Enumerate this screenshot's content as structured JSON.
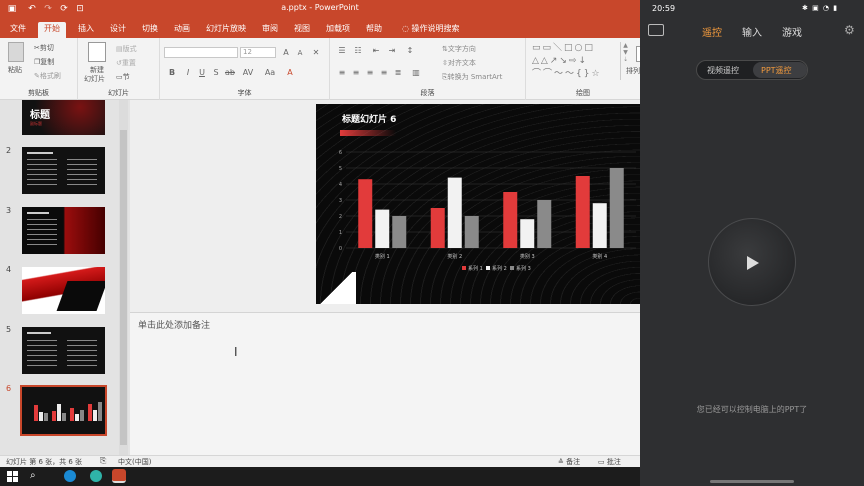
{
  "app": {
    "filename": "a.pptx",
    "separator": "-",
    "name": "PowerPoint"
  },
  "ribbon": {
    "tabs": [
      "文件",
      "开始",
      "插入",
      "设计",
      "切换",
      "动画",
      "幻灯片放映",
      "审阅",
      "视图",
      "加载项",
      "帮助"
    ],
    "tell_me": "操作说明搜索",
    "clipboard": {
      "paste": "粘贴",
      "cut": "剪切",
      "copy": "复制",
      "format_painter": "格式刷",
      "label": "剪贴板"
    },
    "slides": {
      "new_slide": "新建",
      "new_slide2": "幻灯片",
      "layout": "版式",
      "reset": "重置",
      "section": "节",
      "label": "幻灯片"
    },
    "font": {
      "size": "12",
      "label": "字体",
      "buttons": [
        "B",
        "I",
        "U",
        "S",
        "ab",
        "AV",
        "Aa",
        "A"
      ],
      "grow": "A",
      "shrink": "A"
    },
    "paragraph": {
      "text_direction": "文字方向",
      "align_text": "对齐文本",
      "smartart": "转换为 SmartArt",
      "label": "段落"
    },
    "drawing": {
      "arrange": "排列",
      "label": "绘图"
    }
  },
  "thumbnails": [
    {
      "num": "2"
    },
    {
      "num": "3"
    },
    {
      "num": "4"
    },
    {
      "num": "5"
    },
    {
      "num": "6"
    }
  ],
  "thumb1": {
    "title": "标题",
    "sub": "副标题"
  },
  "slide": {
    "title": "标题幻灯片 6"
  },
  "chart_data": {
    "type": "bar",
    "categories": [
      "类别 1",
      "类别 2",
      "类别 3",
      "类别 4"
    ],
    "series": [
      {
        "name": "系列 1",
        "values": [
          4.3,
          2.5,
          3.5,
          4.5
        ],
        "color": "#e23b3b"
      },
      {
        "name": "系列 2",
        "values": [
          2.4,
          4.4,
          1.8,
          2.8
        ],
        "color": "#f2f2f2"
      },
      {
        "name": "系列 3",
        "values": [
          2,
          2,
          3,
          5
        ],
        "color": "#8a8a8a"
      }
    ],
    "ylim": [
      0,
      6
    ],
    "yticks": [
      "0",
      "1",
      "2",
      "3",
      "4",
      "5",
      "6"
    ],
    "grid": true,
    "legend": "bottom"
  },
  "notes": {
    "placeholder": "单击此处添加备注"
  },
  "status": {
    "slide_info": "幻灯片 第 6 张，共 6 张",
    "language": "中文(中国)",
    "notes": "备注",
    "comments": "批注"
  },
  "phone": {
    "time": "20:59",
    "tabs": [
      "遥控",
      "输入",
      "游戏"
    ],
    "segments": [
      "视频遥控",
      "PPT遥控"
    ],
    "message": "您已经可以控制电脑上的PPT了"
  }
}
